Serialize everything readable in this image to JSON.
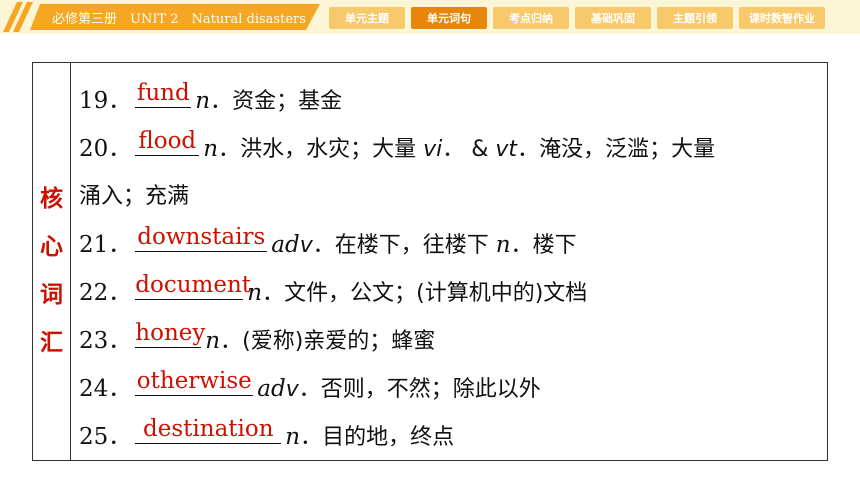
{
  "header": {
    "book_title": "必修第三册　UNIT 2　Natural disasters",
    "tabs": [
      {
        "label": "单元主题",
        "active": false
      },
      {
        "label": "单元词句",
        "active": true
      },
      {
        "label": "考点归纳",
        "active": false
      },
      {
        "label": "基础巩固",
        "active": false
      },
      {
        "label": "主题引领",
        "active": false
      },
      {
        "label": "课时数智作业",
        "active": false
      }
    ]
  },
  "sidebar": {
    "chars": [
      "核",
      "心",
      "词",
      "汇"
    ]
  },
  "colors": {
    "accent": "#f5a623",
    "active_tab": "#e8860c",
    "answer": "#cc1100"
  },
  "vocab": [
    {
      "num": "19．",
      "answer": "fund",
      "pos1": "n",
      "def1": "．资金；基金"
    },
    {
      "num": "20．",
      "answer": "flood",
      "pos1": "n",
      "def1": "．洪水，水灾；大量 ",
      "pos2": "vi",
      "def2": "． & ",
      "pos3": "vt",
      "def3": "．淹没，泛滥；大量",
      "cont": "涌入；充满"
    },
    {
      "num": "21．",
      "answer": "downstairs",
      "pos1": "ad",
      "pos1b": "v",
      "def1": "．在楼下，往楼下 ",
      "pos2": "n",
      "def2": "．楼下"
    },
    {
      "num": "22．",
      "answer": "document",
      "pos1": "n",
      "def1": "．文件，公文；(计算机中的)文档"
    },
    {
      "num": "23．",
      "answer": "honey",
      "pos1": "n",
      "def1": "．(爱称)亲爱的；蜂蜜"
    },
    {
      "num": "24．",
      "answer": "otherwise",
      "pos1": "ad",
      "pos1b": "v",
      "def1": "．否则，不然；除此以外"
    },
    {
      "num": "25．",
      "answer": "destination",
      "pos1": "n",
      "def1": "．目的地，终点"
    }
  ]
}
